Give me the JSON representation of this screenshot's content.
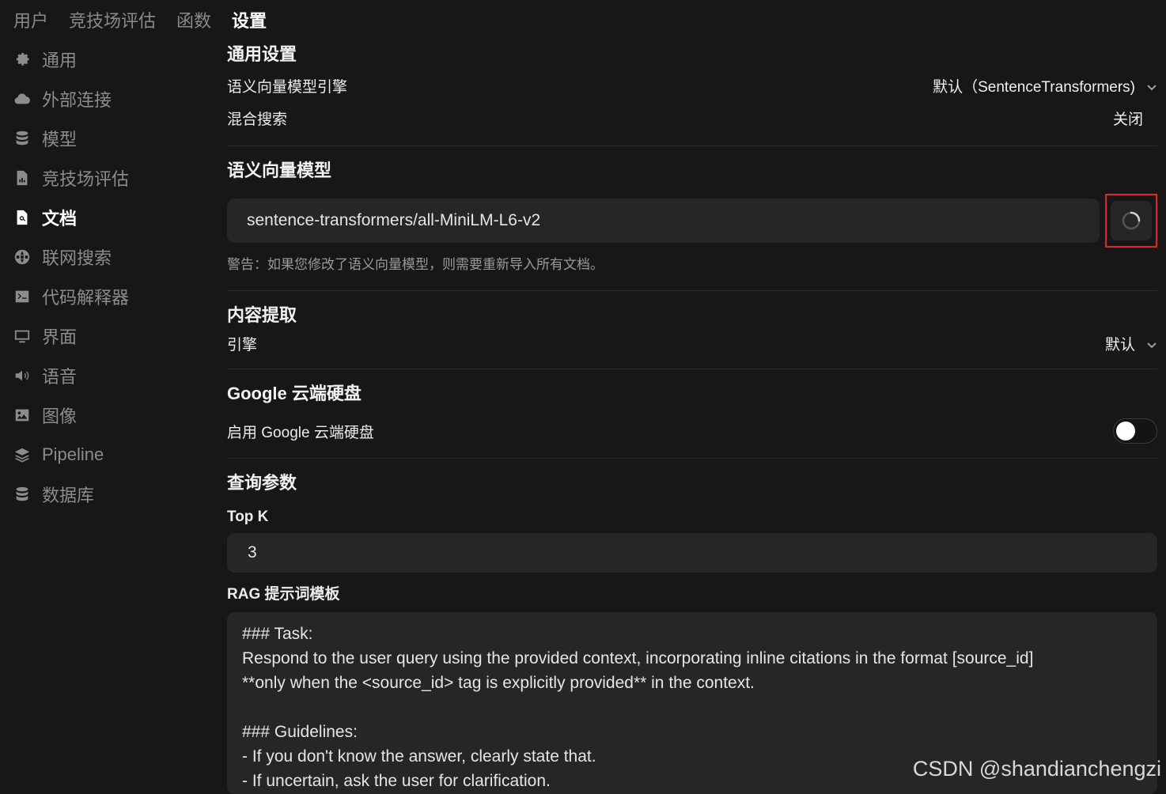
{
  "topnav": [
    "用户",
    "竞技场评估",
    "函数",
    "设置"
  ],
  "sidebar": [
    {
      "label": "通用",
      "icon": "gear-icon"
    },
    {
      "label": "外部连接",
      "icon": "cloud-icon"
    },
    {
      "label": "模型",
      "icon": "database-icon"
    },
    {
      "label": "竞技场评估",
      "icon": "chart-doc-icon"
    },
    {
      "label": "文档",
      "icon": "document-search-icon"
    },
    {
      "label": "联网搜索",
      "icon": "globe-icon"
    },
    {
      "label": "代码解释器",
      "icon": "terminal-icon"
    },
    {
      "label": "界面",
      "icon": "monitor-icon"
    },
    {
      "label": "语音",
      "icon": "speaker-icon"
    },
    {
      "label": "图像",
      "icon": "image-icon"
    },
    {
      "label": "Pipeline",
      "icon": "layers-icon"
    },
    {
      "label": "数据库",
      "icon": "database-icon"
    }
  ],
  "general": {
    "title": "通用设置",
    "engine_label": "语义向量模型引擎",
    "engine_value": "默认（SentenceTransformers)",
    "hybrid_label": "混合搜索",
    "hybrid_value": "关闭"
  },
  "embedding": {
    "title": "语义向量模型",
    "model_value": "sentence-transformers/all-MiniLM-L6-v2",
    "warning": "警告：如果您修改了语义向量模型，则需要重新导入所有文档。"
  },
  "extraction": {
    "title": "内容提取",
    "engine_label": "引擎",
    "engine_value": "默认"
  },
  "gdrive": {
    "title": "Google 云端硬盘",
    "enable_label": "启用 Google 云端硬盘"
  },
  "query": {
    "title": "查询参数",
    "topk_label": "Top K",
    "topk_value": "3",
    "rag_label": "RAG 提示词模板",
    "rag_template": "### Task:\nRespond to the user query using the provided context, incorporating inline citations in the format [source_id]\n**only when the <source_id> tag is explicitly provided** in the context.\n\n### Guidelines:\n- If you don't know the answer, clearly state that.\n- If uncertain, ask the user for clarification."
  },
  "watermark": "CSDN @shandianchengzi"
}
